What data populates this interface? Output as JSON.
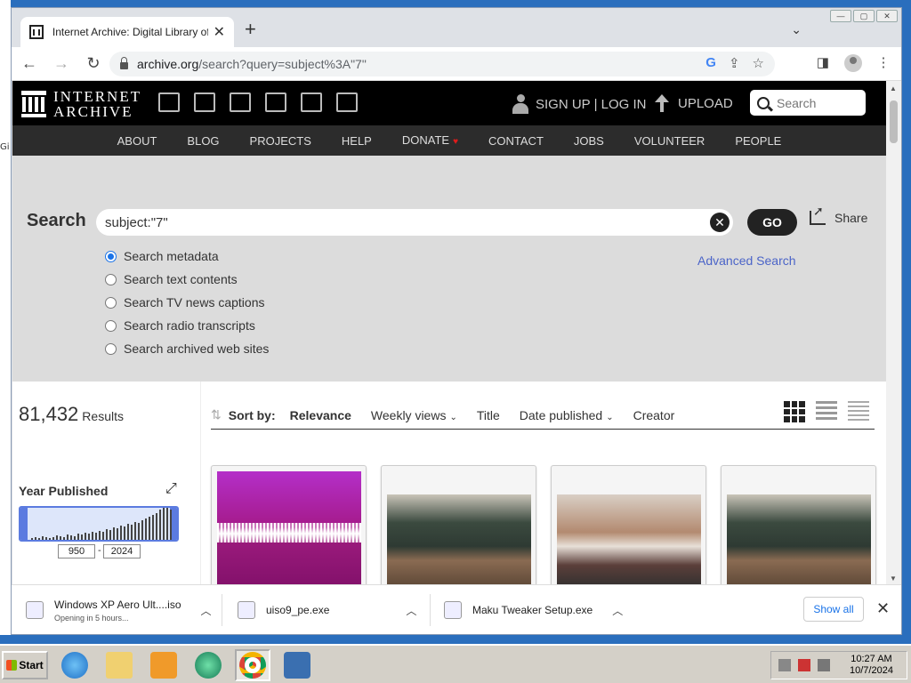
{
  "desktop": {
    "edge_label": "Gi"
  },
  "browser": {
    "tab_title": "Internet Archive: Digital Library of F",
    "url_host": "archive.org",
    "url_path": "/search?query=subject%3A\"7\""
  },
  "ia": {
    "logo_line1": "INTERNET",
    "logo_line2": "ARCHIVE",
    "signup": "SIGN UP | LOG IN",
    "upload": "UPLOAD",
    "search_placeholder": "Search",
    "nav": [
      "ABOUT",
      "BLOG",
      "PROJECTS",
      "HELP",
      "DONATE",
      "CONTACT",
      "JOBS",
      "VOLUNTEER",
      "PEOPLE"
    ]
  },
  "search": {
    "label": "Search",
    "query": "subject:\"7\"",
    "go": "GO",
    "share": "Share",
    "advanced": "Advanced Search",
    "options": [
      "Search metadata",
      "Search text contents",
      "Search TV news captions",
      "Search radio transcripts",
      "Search archived web sites"
    ]
  },
  "results": {
    "count": "81,432",
    "count_label": "Results",
    "year_title": "Year Published",
    "year_from": "950",
    "year_to": "2024",
    "sort_label": "Sort by:",
    "sort_options": [
      "Relevance",
      "Weekly views",
      "Title",
      "Date published",
      "Creator"
    ]
  },
  "downloads": [
    {
      "name": "Windows XP Aero Ult....iso",
      "status": "Opening in 5 hours..."
    },
    {
      "name": "uiso9_pe.exe",
      "status": ""
    },
    {
      "name": "Maku Tweaker Setup.exe",
      "status": ""
    }
  ],
  "shelf": {
    "show_all": "Show all"
  },
  "taskbar": {
    "start": "Start",
    "time": "10:27 AM",
    "date": "10/7/2024"
  }
}
